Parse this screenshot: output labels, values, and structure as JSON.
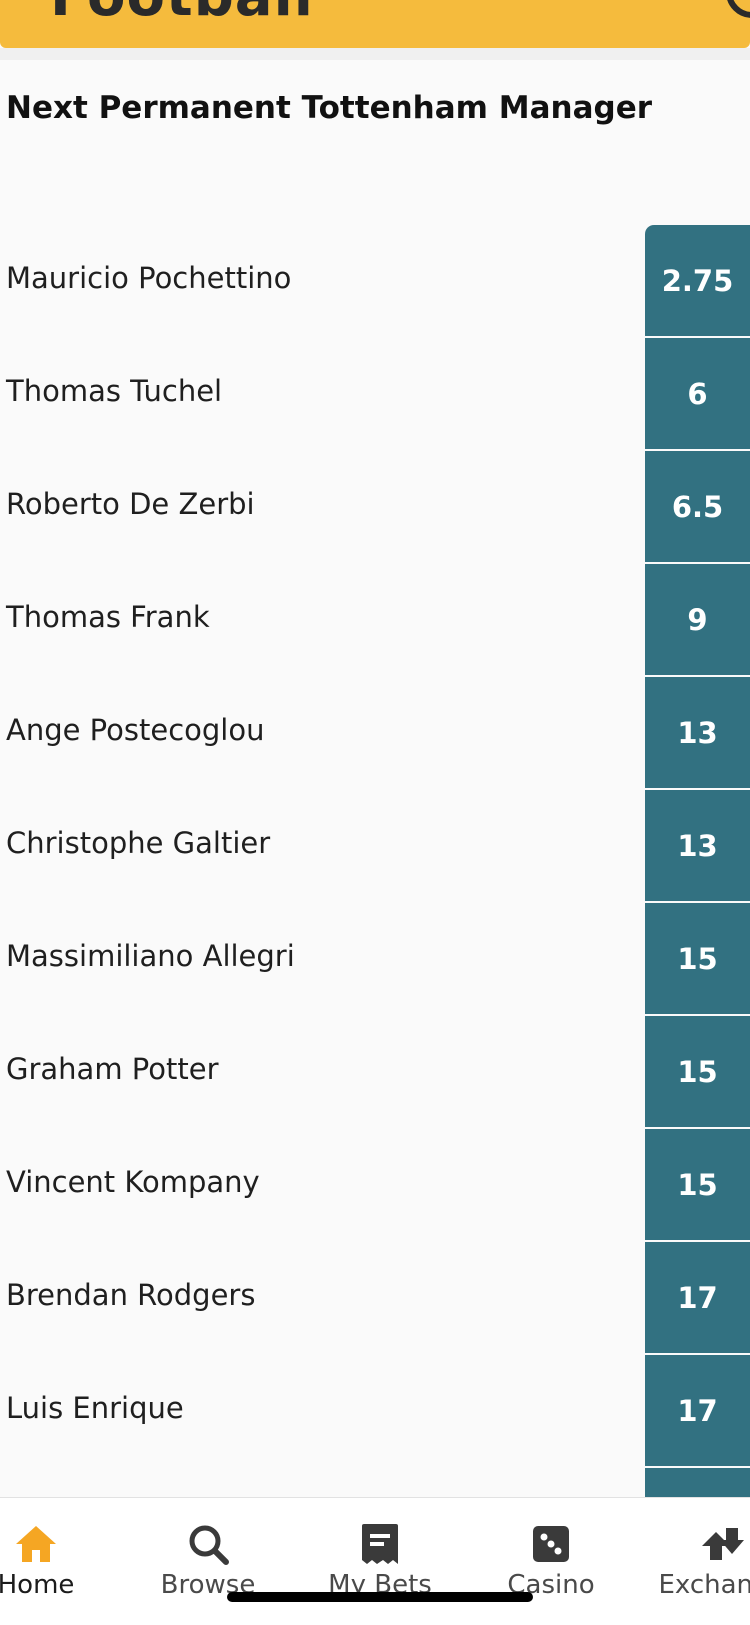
{
  "header": {
    "title": "Football",
    "search_icon": "search-icon",
    "color": "#f5bb3d"
  },
  "market": {
    "title": "Next Permanent Tottenham Manager"
  },
  "selections": [
    {
      "name": "Mauricio Pochettino",
      "odds": "2.75"
    },
    {
      "name": "Thomas Tuchel",
      "odds": "6"
    },
    {
      "name": "Roberto De Zerbi",
      "odds": "6.5"
    },
    {
      "name": "Thomas Frank",
      "odds": "9"
    },
    {
      "name": "Ange Postecoglou",
      "odds": "13"
    },
    {
      "name": "Christophe Galtier",
      "odds": "13"
    },
    {
      "name": "Massimiliano Allegri",
      "odds": "15"
    },
    {
      "name": "Graham Potter",
      "odds": "15"
    },
    {
      "name": "Vincent Kompany",
      "odds": "15"
    },
    {
      "name": "Brendan Rodgers",
      "odds": "17"
    },
    {
      "name": "Luis Enrique",
      "odds": "17"
    }
  ],
  "odds_color": "#327181",
  "bottom_nav": {
    "items": [
      {
        "label": "Home",
        "icon": "home-icon",
        "active": true
      },
      {
        "label": "Browse",
        "icon": "search-icon",
        "active": false
      },
      {
        "label": "My Bets",
        "icon": "receipt-icon",
        "active": false
      },
      {
        "label": "Casino",
        "icon": "dice-icon",
        "active": false
      },
      {
        "label": "Exchange",
        "icon": "exchange-icon",
        "active": false
      }
    ],
    "active_color": "#f5a623"
  }
}
